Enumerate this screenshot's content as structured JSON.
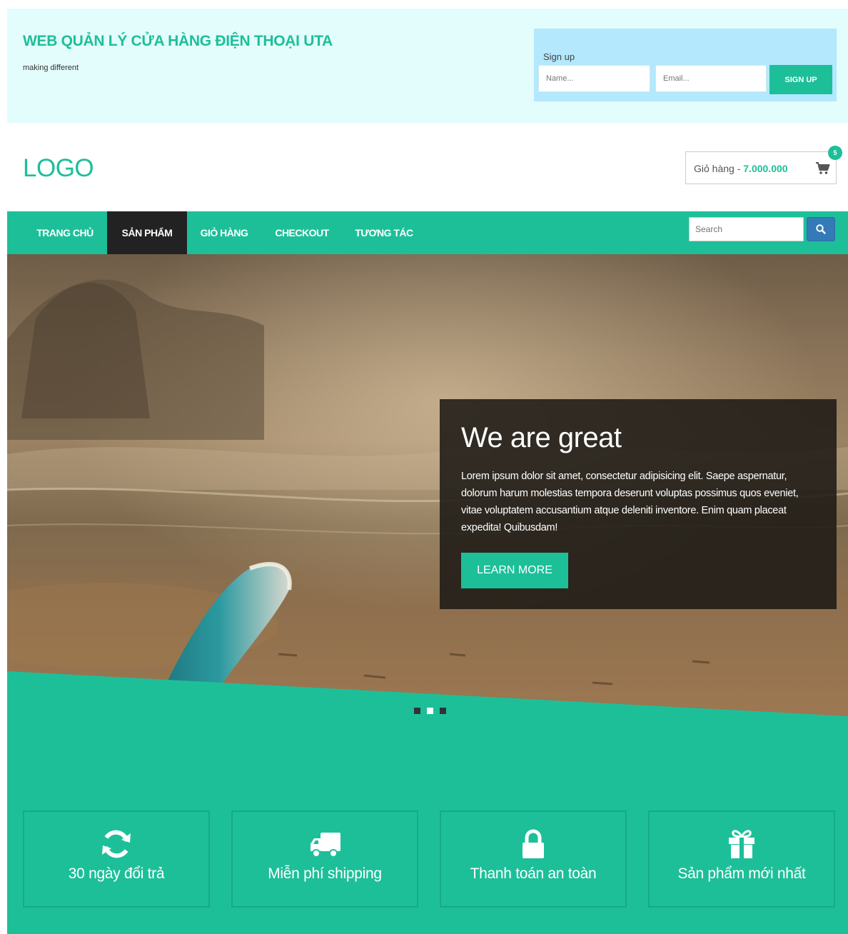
{
  "header": {
    "title": "WEB QUẢN LÝ CỬA HÀNG ĐIỆN THOẠI UTA",
    "tagline": "making different",
    "signup": {
      "label": "Sign up",
      "name_placeholder": "Name...",
      "email_placeholder": "Email...",
      "button": "SIGN UP"
    }
  },
  "logo": "LOGO",
  "cart": {
    "label": "Giỏ hàng - ",
    "amount": "7.000.000",
    "badge": "5",
    "icon": "shopping-cart-icon"
  },
  "nav": {
    "items": [
      {
        "label": "TRANG CHỦ",
        "active": false
      },
      {
        "label": "SẢN PHẨM",
        "active": true
      },
      {
        "label": "GIỎ HÀNG",
        "active": false
      },
      {
        "label": "CHECKOUT",
        "active": false
      },
      {
        "label": "TƯƠNG TÁC",
        "active": false
      }
    ],
    "search_placeholder": "Search",
    "search_icon": "search-icon"
  },
  "hero": {
    "title": "We are great",
    "text": "Lorem ipsum dolor sit amet, consectetur adipisicing elit. Saepe aspernatur, dolorum harum molestias tempora deserunt voluptas possimus quos eveniet, vitae voluptatem accusantium atque deleniti inventore. Enim quam placeat expedita! Quibusdam!",
    "button": "LEARN MORE",
    "slides_count": 3,
    "active_slide": 1
  },
  "features": [
    {
      "icon": "refresh-icon",
      "label": "30 ngày đổi trả"
    },
    {
      "icon": "truck-icon",
      "label": "Miễn phí shipping"
    },
    {
      "icon": "lock-icon",
      "label": "Thanh toán an toàn"
    },
    {
      "icon": "gift-icon",
      "label": "Sản phẩm mới nhất"
    }
  ],
  "colors": {
    "accent": "#1dbf99",
    "top_bar_bg": "#e3fcfc",
    "signup_bg": "#b3e8fd",
    "nav_active": "#222222",
    "search_button": "#337ab7"
  }
}
